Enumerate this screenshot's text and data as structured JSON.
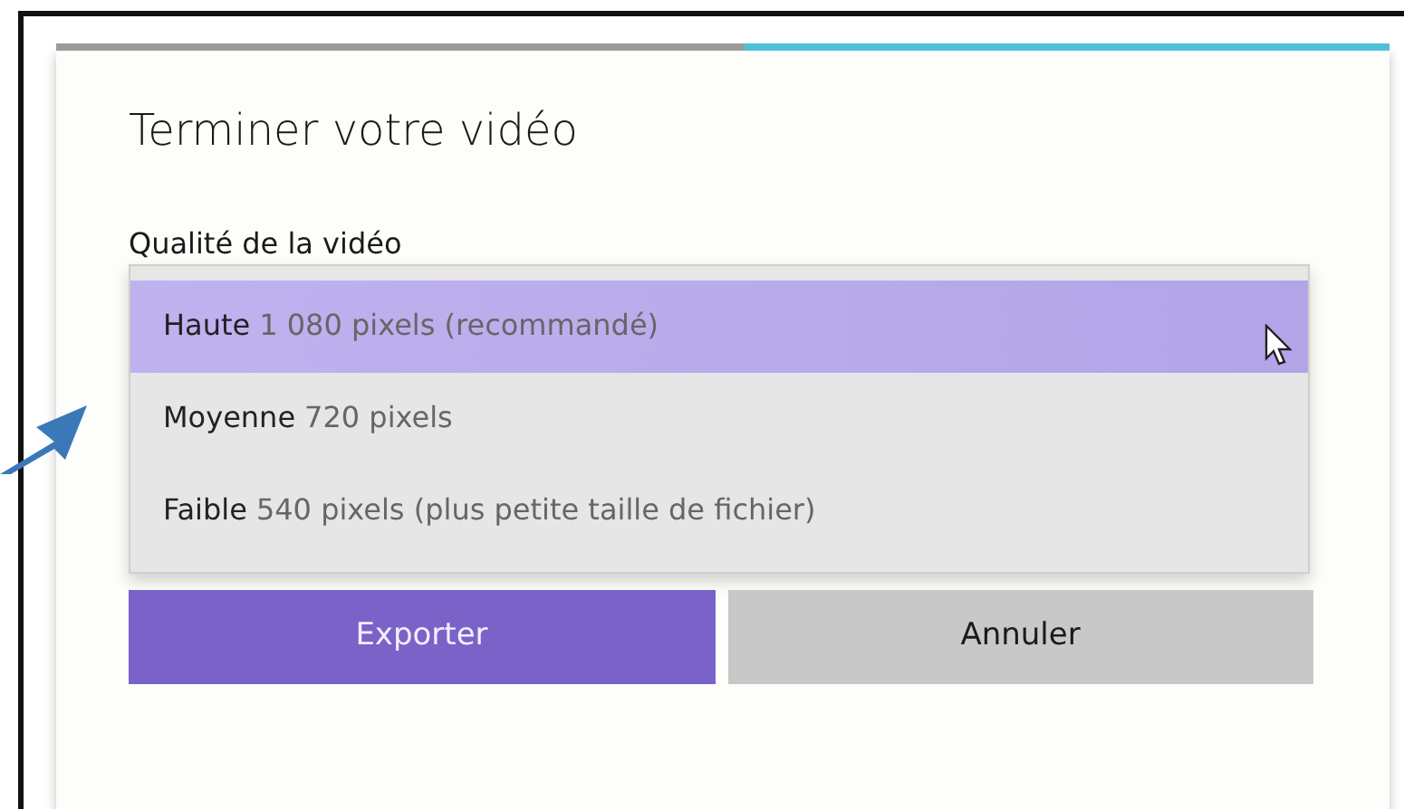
{
  "dialog": {
    "title": "Terminer votre vidéo",
    "field_label": "Qualité de la vidéo",
    "options": [
      {
        "name": "Haute",
        "detail": "1 080 pixels (recommandé)",
        "selected": true
      },
      {
        "name": "Moyenne",
        "detail": "720 pixels",
        "selected": false
      },
      {
        "name": "Faible",
        "detail": "540 pixels (plus petite taille de fichier)",
        "selected": false
      }
    ],
    "buttons": [
      {
        "label": "Exporter",
        "kind": "primary"
      },
      {
        "label": "Annuler",
        "kind": "secondary"
      }
    ]
  }
}
